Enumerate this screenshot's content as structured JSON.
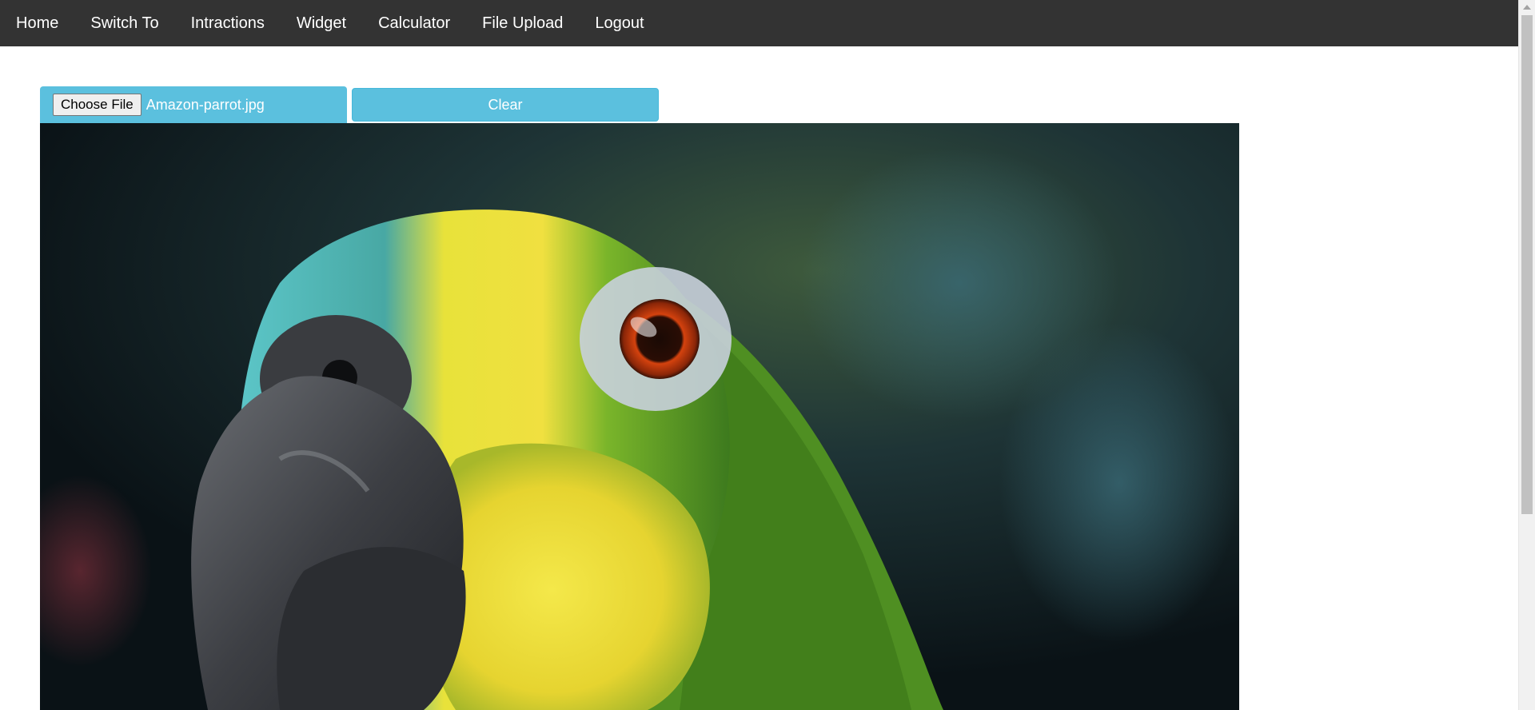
{
  "nav": {
    "items": [
      {
        "label": "Home"
      },
      {
        "label": "Switch To"
      },
      {
        "label": "Intractions"
      },
      {
        "label": "Widget"
      },
      {
        "label": "Calculator"
      },
      {
        "label": "File Upload"
      },
      {
        "label": "Logout"
      }
    ]
  },
  "upload": {
    "choose_label": "Choose File",
    "file_name": "Amazon-parrot.jpg",
    "clear_label": "Clear"
  },
  "colors": {
    "navbar": "#333333",
    "accent": "#5bc0de"
  },
  "preview": {
    "subject": "parrot-photo"
  }
}
